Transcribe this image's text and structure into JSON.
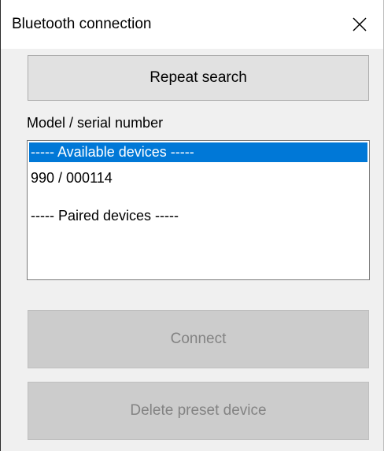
{
  "window": {
    "title": "Bluetooth connection"
  },
  "buttons": {
    "repeat_search": "Repeat search",
    "connect": "Connect",
    "delete_preset": "Delete preset device"
  },
  "list": {
    "label": "Model / serial number",
    "items": [
      {
        "text": "----- Available devices -----",
        "selected": true
      },
      {
        "text": "990 / 000114",
        "selected": false
      },
      {
        "text": "",
        "selected": false
      },
      {
        "text": "----- Paired devices -----",
        "selected": false
      }
    ]
  },
  "icons": {
    "close": "close-icon"
  },
  "colors": {
    "selection": "#0078d7",
    "disabled_text": "#838383"
  }
}
